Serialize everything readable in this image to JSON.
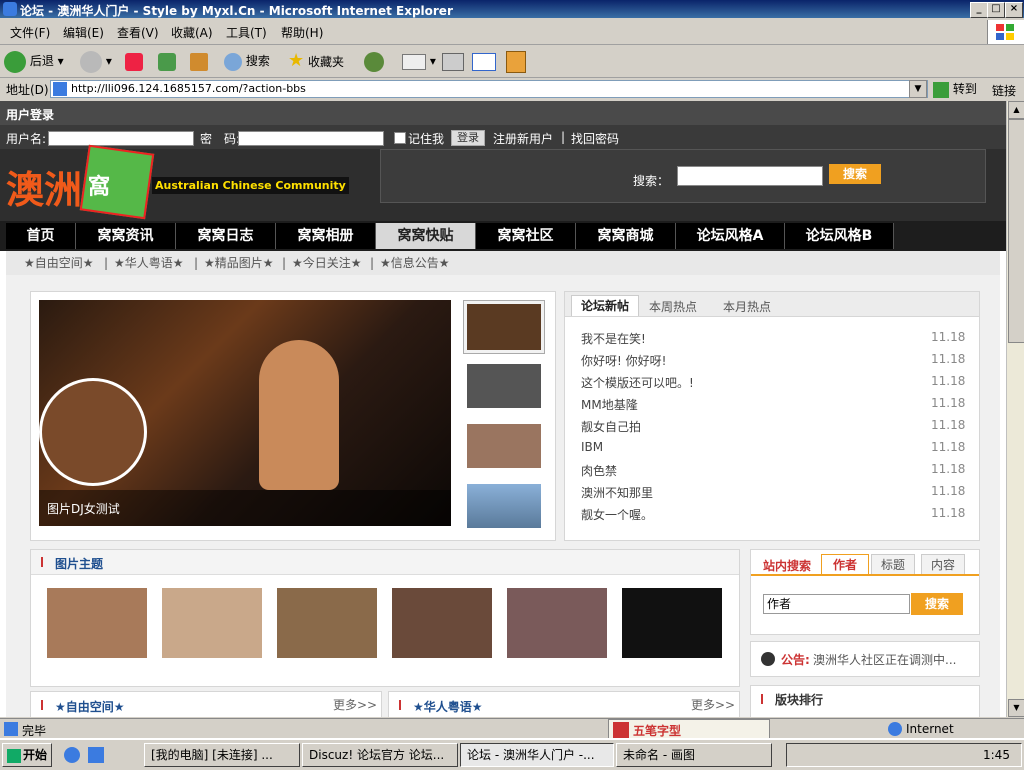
{
  "window": {
    "title": "论坛 - 澳洲华人门户 - Style by Myxl.Cn - Microsoft Internet Explorer",
    "menu": [
      "文件(F)",
      "编辑(E)",
      "查看(V)",
      "收藏(A)",
      "工具(T)",
      "帮助(H)"
    ],
    "toolbar": {
      "back": "后退",
      "search": "搜索",
      "favorites": "收藏夹"
    },
    "address_label": "地址(D)",
    "url": "http://lli096.124.1685157.com/?action-bbs",
    "go": "转到",
    "links": "链接"
  },
  "site": {
    "login_title": "用户登录",
    "username_label": "用户名:",
    "password_label": "密　码:",
    "remember": "记住我",
    "login_btn": "登录",
    "register": "注册新用户",
    "sep": "|",
    "find_password": "找回密码",
    "logo_main": "澳洲",
    "logo_sub": "窩",
    "logo_english": "Australian Chinese Community",
    "search_label": "搜索：",
    "search_btn": "搜索",
    "nav": [
      "首页",
      "窝窝资讯",
      "窝窝日志",
      "窝窝相册",
      "窝窝快贴",
      "窝窝社区",
      "窝窝商城",
      "论坛风格A",
      "论坛风格B"
    ],
    "subnav": [
      "★自由空间★",
      "★华人粤语★",
      "★精品图片★",
      "★今日关注★",
      "★信息公告★"
    ],
    "featured_caption": "图片DJ女测试",
    "hot_tabs": [
      "论坛新帖",
      "本周热点",
      "本月热点"
    ],
    "hot_list": [
      {
        "title": "我不是在笑!",
        "date": "11.18"
      },
      {
        "title": "你好呀! 你好呀!",
        "date": "11.18"
      },
      {
        "title": "这个模版还可以吧。!",
        "date": "11.18"
      },
      {
        "title": "MM地基隆",
        "date": "11.18"
      },
      {
        "title": "靓女自己拍",
        "date": "11.18"
      },
      {
        "title": "IBM",
        "date": "11.18"
      },
      {
        "title": "肉色禁",
        "date": "11.18"
      },
      {
        "title": "澳洲不知那里",
        "date": "11.18"
      },
      {
        "title": "靓女一个喔。",
        "date": "11.18"
      }
    ],
    "pic_section_title": "图片主题",
    "site_search_title": "站内搜索",
    "site_search_tabs": [
      "作者",
      "标题",
      "内容"
    ],
    "site_search_value": "作者",
    "site_search_btn": "搜索",
    "notice_label": "公告:",
    "notice_text": "澳洲华人社区正在调测中...",
    "rank_title": "版块排行",
    "bottom_sections": [
      {
        "title": "★自由空间★",
        "more": "更多>>"
      },
      {
        "title": "★华人粤语★",
        "more": "更多>>"
      }
    ]
  },
  "statusbar": {
    "left": "完毕",
    "ime": "五笔字型",
    "zone": "Internet"
  },
  "taskbar": {
    "start": "开始",
    "items": [
      "[我的电脑] [未连接] ...",
      "Discuz! 论坛官方 论坛...",
      "论坛 - 澳洲华人门户 -...",
      "未命名 - 画图"
    ],
    "time": "1:45"
  },
  "colors": {
    "accent_orange": "#f0a020",
    "nav_bg": "#000000",
    "link_blue": "#1f4f8f",
    "title_blue": "#0a246a"
  }
}
